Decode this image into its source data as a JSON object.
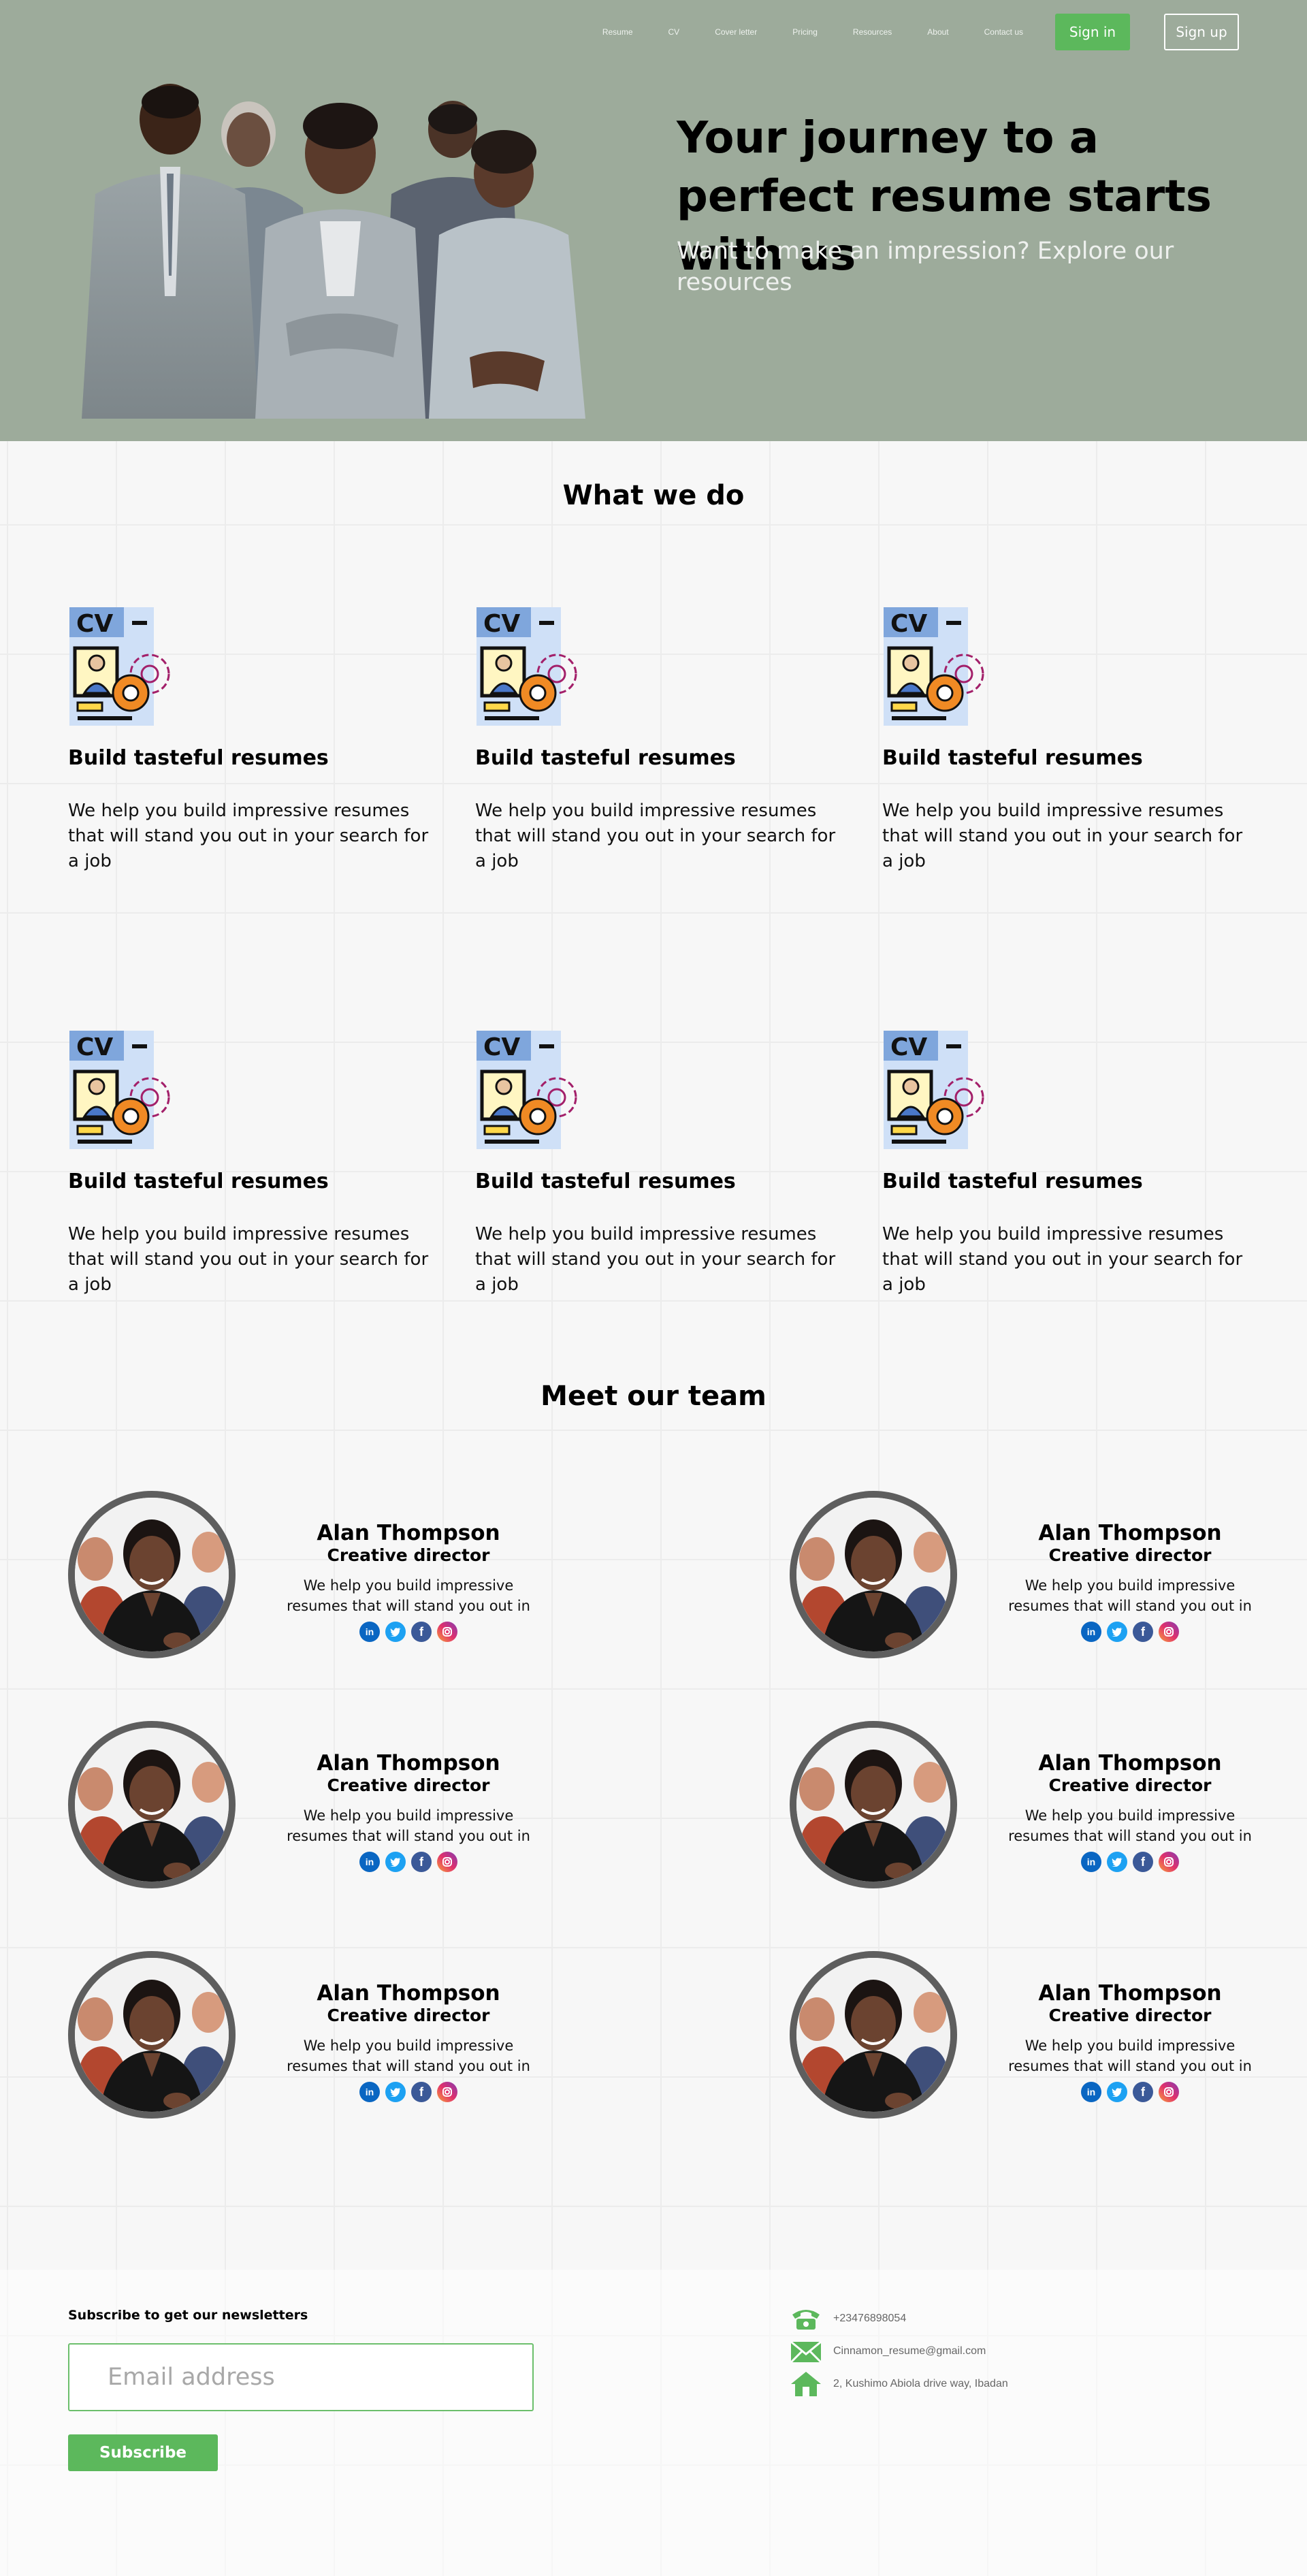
{
  "nav": {
    "links": [
      "Resume",
      "CV",
      "Cover letter",
      "Pricing",
      "Resources",
      "About",
      "Contact us"
    ],
    "signin_label": "Sign in",
    "signup_label": "Sign up"
  },
  "hero": {
    "title": "Your journey to a perfect resume starts with us",
    "subtitle": "Want to make an impression? Explore our resources"
  },
  "what_we_do": {
    "heading": "What we do",
    "items": [
      {
        "icon": "cv-icon",
        "title": "Build tasteful resumes",
        "text": "We help you build impressive resumes that will stand you out in your search for a job"
      },
      {
        "icon": "cv-icon",
        "title": "Build tasteful resumes",
        "text": "We help you build impressive resumes that will stand you out in your search for a job"
      },
      {
        "icon": "cv-icon",
        "title": "Build tasteful resumes",
        "text": "We help you build impressive resumes that will stand you out in your search for a job"
      },
      {
        "icon": "cv-icon",
        "title": "Build tasteful resumes",
        "text": "We help you build impressive resumes that will stand you out in your search for a job"
      },
      {
        "icon": "cv-icon",
        "title": "Build tasteful resumes",
        "text": "We help you build impressive resumes that will stand you out in your search for a job"
      },
      {
        "icon": "cv-icon",
        "title": "Build tasteful resumes",
        "text": "We help you build impressive resumes that will stand you out in your search for a job"
      }
    ],
    "icon_text": "CV"
  },
  "team": {
    "heading": "Meet our team",
    "members": [
      {
        "name": "Alan Thompson",
        "role": "Creative director",
        "bio": "We help you build impressive resumes that will stand you out in"
      },
      {
        "name": "Alan Thompson",
        "role": "Creative director",
        "bio": "We help you build impressive resumes that will stand you out in"
      },
      {
        "name": "Alan Thompson",
        "role": "Creative director",
        "bio": "We help you build impressive resumes that will stand you out in"
      },
      {
        "name": "Alan Thompson",
        "role": "Creative director",
        "bio": "We help you build impressive resumes that will stand you out in"
      },
      {
        "name": "Alan Thompson",
        "role": "Creative director",
        "bio": "We help you build impressive resumes that will stand you out in"
      },
      {
        "name": "Alan Thompson",
        "role": "Creative director",
        "bio": "We help you build impressive resumes that will stand you out in"
      }
    ],
    "social_icons": [
      "linkedin-icon",
      "twitter-icon",
      "facebook-icon",
      "instagram-icon"
    ]
  },
  "footer": {
    "subscribe_label": "Subscribe to get our newsletters",
    "email_placeholder": "Email address",
    "subscribe_button": "Subscribe",
    "contacts": [
      {
        "icon": "phone-icon",
        "text": "+23476898054"
      },
      {
        "icon": "mail-icon",
        "text": "Cinnamon_resume@gmail.com"
      },
      {
        "icon": "home-icon",
        "text": "2, Kushimo Abiola drive way, Ibadan"
      }
    ]
  },
  "colors": {
    "hero_bg": "#9dab9b",
    "accent_green": "#5cb85c",
    "avatar_ring": "#5e5e5e"
  }
}
